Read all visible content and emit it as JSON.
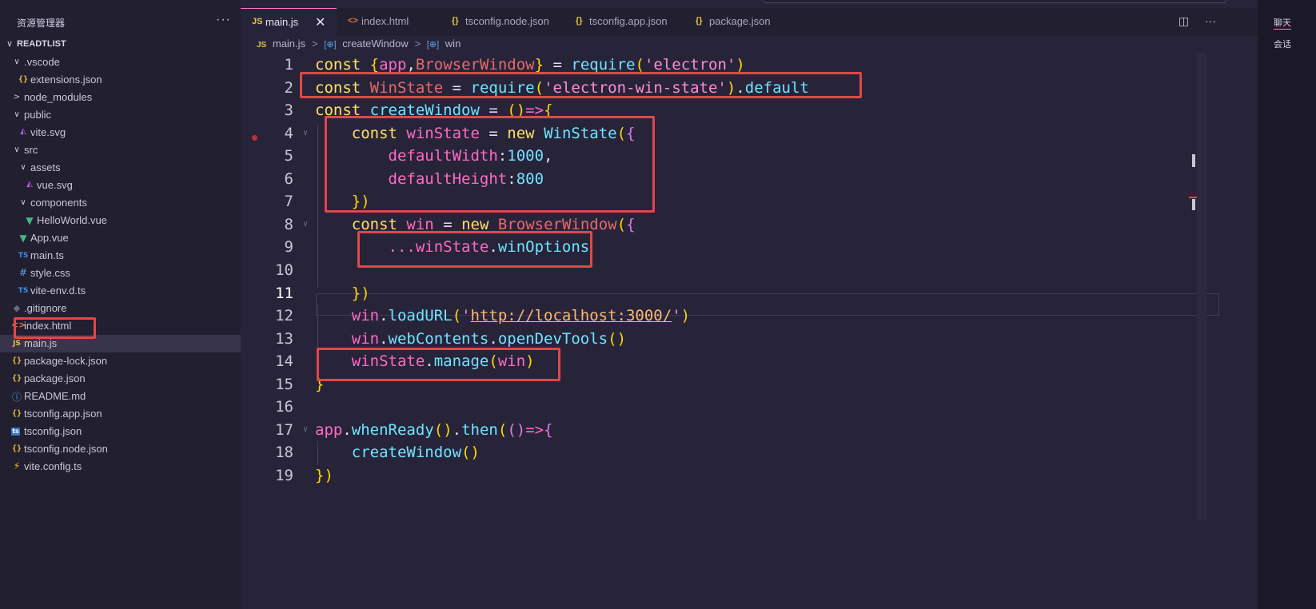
{
  "sidebar": {
    "title": "资源管理器",
    "more": "···",
    "root": "READTLIST",
    "items": [
      {
        "label": ".vscode",
        "icon": "folder-open-icon",
        "glyph": "∨",
        "kind": "folder"
      },
      {
        "label": "extensions.json",
        "icon": "json-icon",
        "glyph": "{}",
        "kind": "json"
      },
      {
        "label": "node_modules",
        "icon": "folder-closed-icon",
        "glyph": ">",
        "kind": "folder"
      },
      {
        "label": "public",
        "icon": "folder-open-icon",
        "glyph": "∨",
        "kind": "folder"
      },
      {
        "label": "vite.svg",
        "icon": "svg-icon",
        "glyph": "◭",
        "kind": "svg"
      },
      {
        "label": "src",
        "icon": "folder-open-icon",
        "glyph": "∨",
        "kind": "folder"
      },
      {
        "label": "assets",
        "icon": "folder-open-icon",
        "glyph": "∨",
        "kind": "folder"
      },
      {
        "label": "vue.svg",
        "icon": "svg-icon",
        "glyph": "◭",
        "kind": "svg"
      },
      {
        "label": "components",
        "icon": "folder-open-icon",
        "glyph": "∨",
        "kind": "folder"
      },
      {
        "label": "HelloWorld.vue",
        "icon": "vue-icon",
        "glyph": "▼",
        "kind": "vue"
      },
      {
        "label": "App.vue",
        "icon": "vue-icon",
        "glyph": "▼",
        "kind": "vue"
      },
      {
        "label": "main.ts",
        "icon": "typescript-icon",
        "glyph": "TS",
        "kind": "ts"
      },
      {
        "label": "style.css",
        "icon": "css-icon",
        "glyph": "#",
        "kind": "css"
      },
      {
        "label": "vite-env.d.ts",
        "icon": "typescript-icon",
        "glyph": "TS",
        "kind": "ts"
      },
      {
        "label": ".gitignore",
        "icon": "git-icon",
        "glyph": "◆",
        "kind": "git"
      },
      {
        "label": "index.html",
        "icon": "html-icon",
        "glyph": "<>",
        "kind": "html"
      },
      {
        "label": "main.js",
        "icon": "javascript-icon",
        "glyph": "JS",
        "kind": "js"
      },
      {
        "label": "package-lock.json",
        "icon": "json-icon",
        "glyph": "{}",
        "kind": "json"
      },
      {
        "label": "package.json",
        "icon": "json-icon",
        "glyph": "{}",
        "kind": "json"
      },
      {
        "label": "README.md",
        "icon": "info-icon",
        "glyph": "ⓘ",
        "kind": "info"
      },
      {
        "label": "tsconfig.app.json",
        "icon": "json-icon",
        "glyph": "{}",
        "kind": "json"
      },
      {
        "label": "tsconfig.json",
        "icon": "tsconfig-icon",
        "glyph": "ts",
        "kind": "tsbox"
      },
      {
        "label": "tsconfig.node.json",
        "icon": "json-icon",
        "glyph": "{}",
        "kind": "json"
      },
      {
        "label": "vite.config.ts",
        "icon": "vite-icon",
        "glyph": "⚡",
        "kind": "vite"
      }
    ]
  },
  "tabs": [
    {
      "label": "main.js",
      "glyph": "JS",
      "icon": "javascript-icon",
      "active": true,
      "close": "✕"
    },
    {
      "label": "index.html",
      "glyph": "<>",
      "icon": "html-icon"
    },
    {
      "label": "tsconfig.node.json",
      "glyph": "{}",
      "icon": "json-icon"
    },
    {
      "label": "tsconfig.app.json",
      "glyph": "{}",
      "icon": "json-icon"
    },
    {
      "label": "package.json",
      "glyph": "{}",
      "icon": "json-icon"
    }
  ],
  "tab_actions": {
    "split": "◫",
    "more": "···"
  },
  "breadcrumb": {
    "file": "main.js",
    "fn": "createWindow",
    "var": "win"
  },
  "code": {
    "current_line": 11,
    "lines": [
      "const {app,BrowserWindow} = require('electron')",
      "const WinState = require('electron-win-state').default",
      "const createWindow = ()=>{",
      "    const winState = new WinState({",
      "        defaultWidth:1000,",
      "        defaultHeight:800",
      "    })",
      "    const win = new BrowserWindow({",
      "        ...winState.winOptions",
      "",
      "    })",
      "    win.loadURL('http://localhost:3000/')",
      "    win.webContents.openDevTools()",
      "    winState.manage(win)",
      "}",
      "",
      "app.whenReady().then(()=>{",
      "    createWindow()",
      "})"
    ]
  },
  "right_panel": {
    "chat": "聊天",
    "session": "会话"
  },
  "colors": {
    "highlight_box": "#e04848",
    "accent": "#ff79c6",
    "background": "#27243a"
  }
}
